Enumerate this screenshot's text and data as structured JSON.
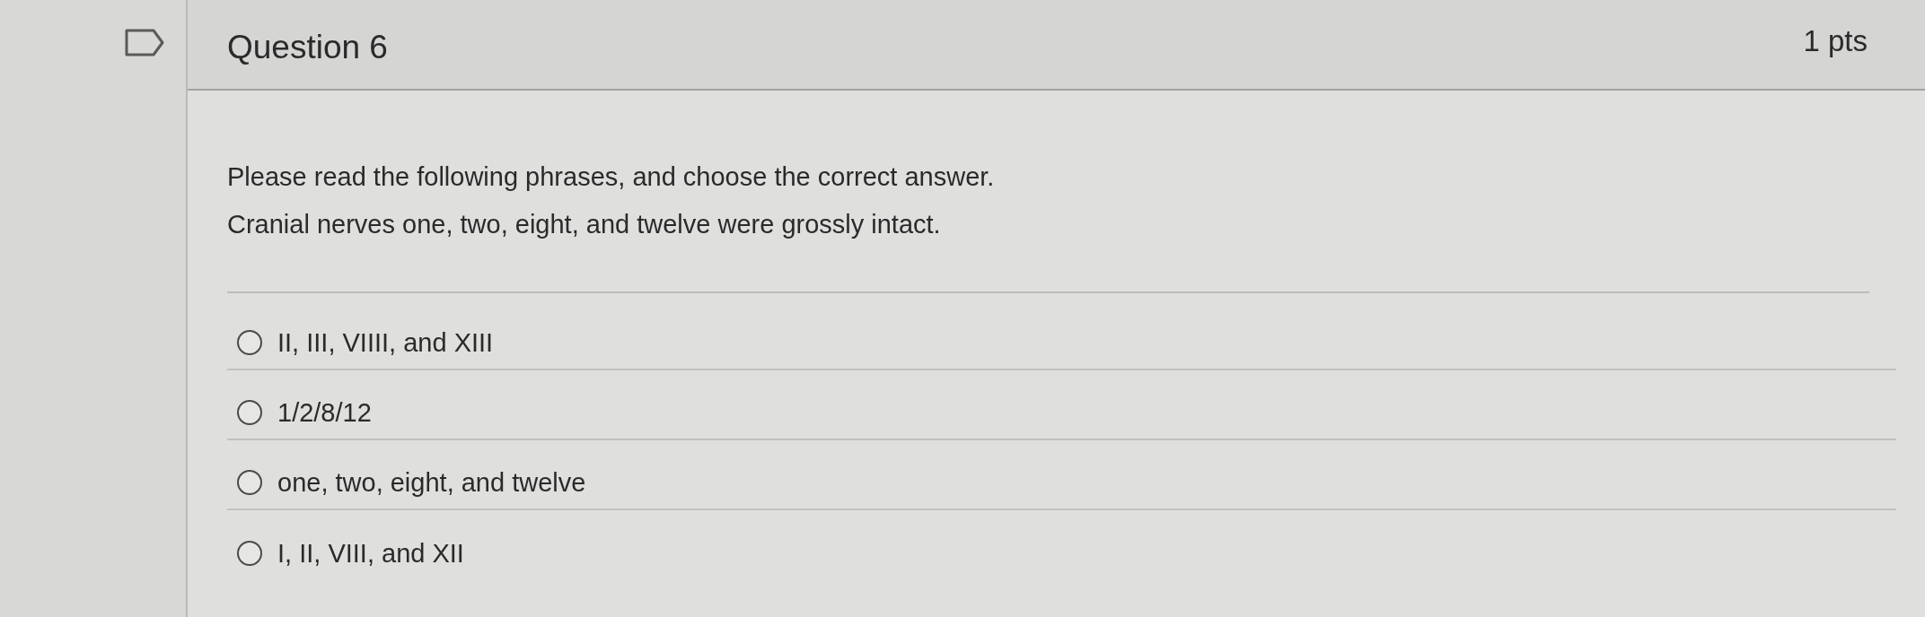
{
  "question": {
    "title": "Question 6",
    "points": "1 pts",
    "flagged": false
  },
  "prompt": [
    "Please read the following phrases, and choose the correct answer.",
    "Cranial nerves one, two, eight, and twelve were grossly intact."
  ],
  "answers": [
    {
      "label": "II, III, VIIII, and XIII",
      "selected": false
    },
    {
      "label": "1/2/8/12",
      "selected": false
    },
    {
      "label": "one, two, eight, and twelve",
      "selected": false
    },
    {
      "label": "I, II, VIII, and XII",
      "selected": false
    }
  ]
}
